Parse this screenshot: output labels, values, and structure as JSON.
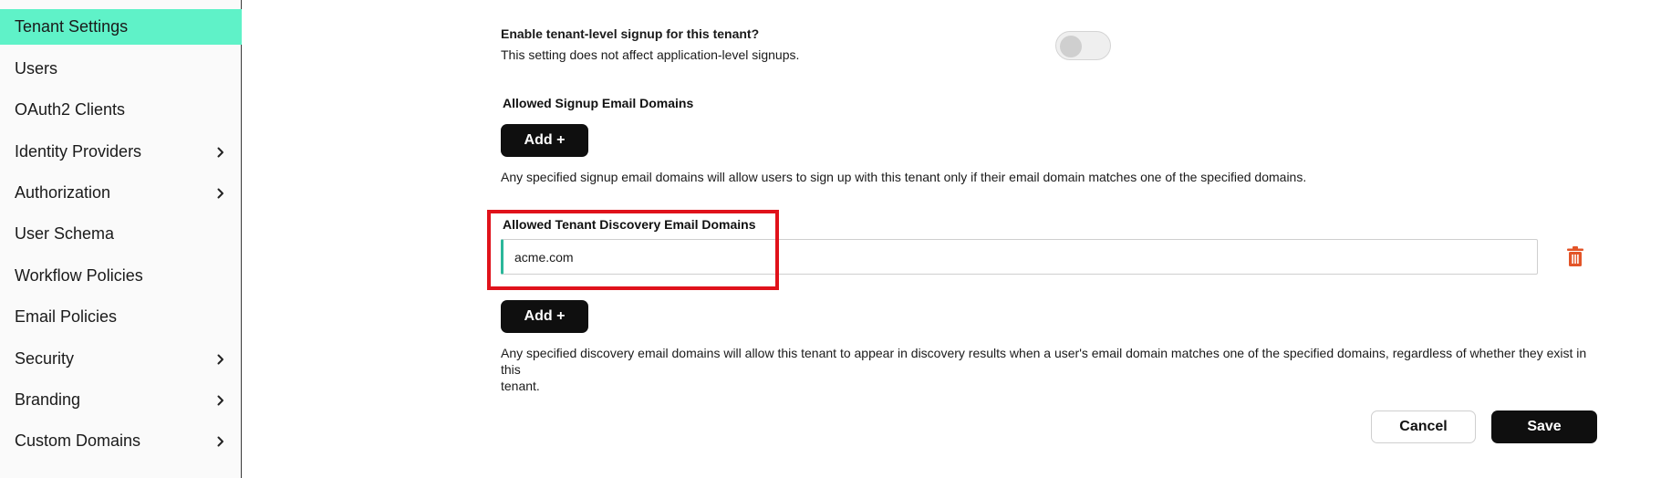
{
  "sidebar": {
    "items": [
      {
        "label": "Tenant Settings",
        "active": true,
        "has_chevron": false
      },
      {
        "label": "Users",
        "active": false,
        "has_chevron": false
      },
      {
        "label": "OAuth2 Clients",
        "active": false,
        "has_chevron": false
      },
      {
        "label": "Identity Providers",
        "active": false,
        "has_chevron": true
      },
      {
        "label": "Authorization",
        "active": false,
        "has_chevron": true
      },
      {
        "label": "User Schema",
        "active": false,
        "has_chevron": false
      },
      {
        "label": "Workflow Policies",
        "active": false,
        "has_chevron": false
      },
      {
        "label": "Email Policies",
        "active": false,
        "has_chevron": false
      },
      {
        "label": "Security",
        "active": false,
        "has_chevron": true
      },
      {
        "label": "Branding",
        "active": false,
        "has_chevron": true
      },
      {
        "label": "Custom Domains",
        "active": false,
        "has_chevron": true
      }
    ],
    "chevron_icon": "chevron-right-icon",
    "active_color": "#5ff2c8"
  },
  "signup": {
    "question": "Enable tenant-level signup for this tenant?",
    "note": "This setting does not affect application-level signups.",
    "toggle_enabled": false
  },
  "signup_domains": {
    "label": "Allowed Signup Email Domains",
    "add_label": "Add +",
    "help": "Any specified signup email domains will allow users to sign up with this tenant only if their email domain matches one of the specified domains."
  },
  "discovery_domains": {
    "label": "Allowed Tenant Discovery Email Domains",
    "entries": [
      "acme.com"
    ],
    "delete_icon": "trash-icon",
    "add_label": "Add +",
    "help_line1": "Any specified discovery email domains will allow this tenant to appear in discovery results when a user's email domain matches one of the specified domains, regardless of whether they exist in this",
    "help_line2": "tenant."
  },
  "actions": {
    "cancel_label": "Cancel",
    "save_label": "Save"
  },
  "colors": {
    "accent": "#5ff2c8",
    "input_accent": "#2bb79a",
    "danger": "#e35428",
    "highlight": "#e0121b",
    "primary_button": "#0f0f0f"
  }
}
